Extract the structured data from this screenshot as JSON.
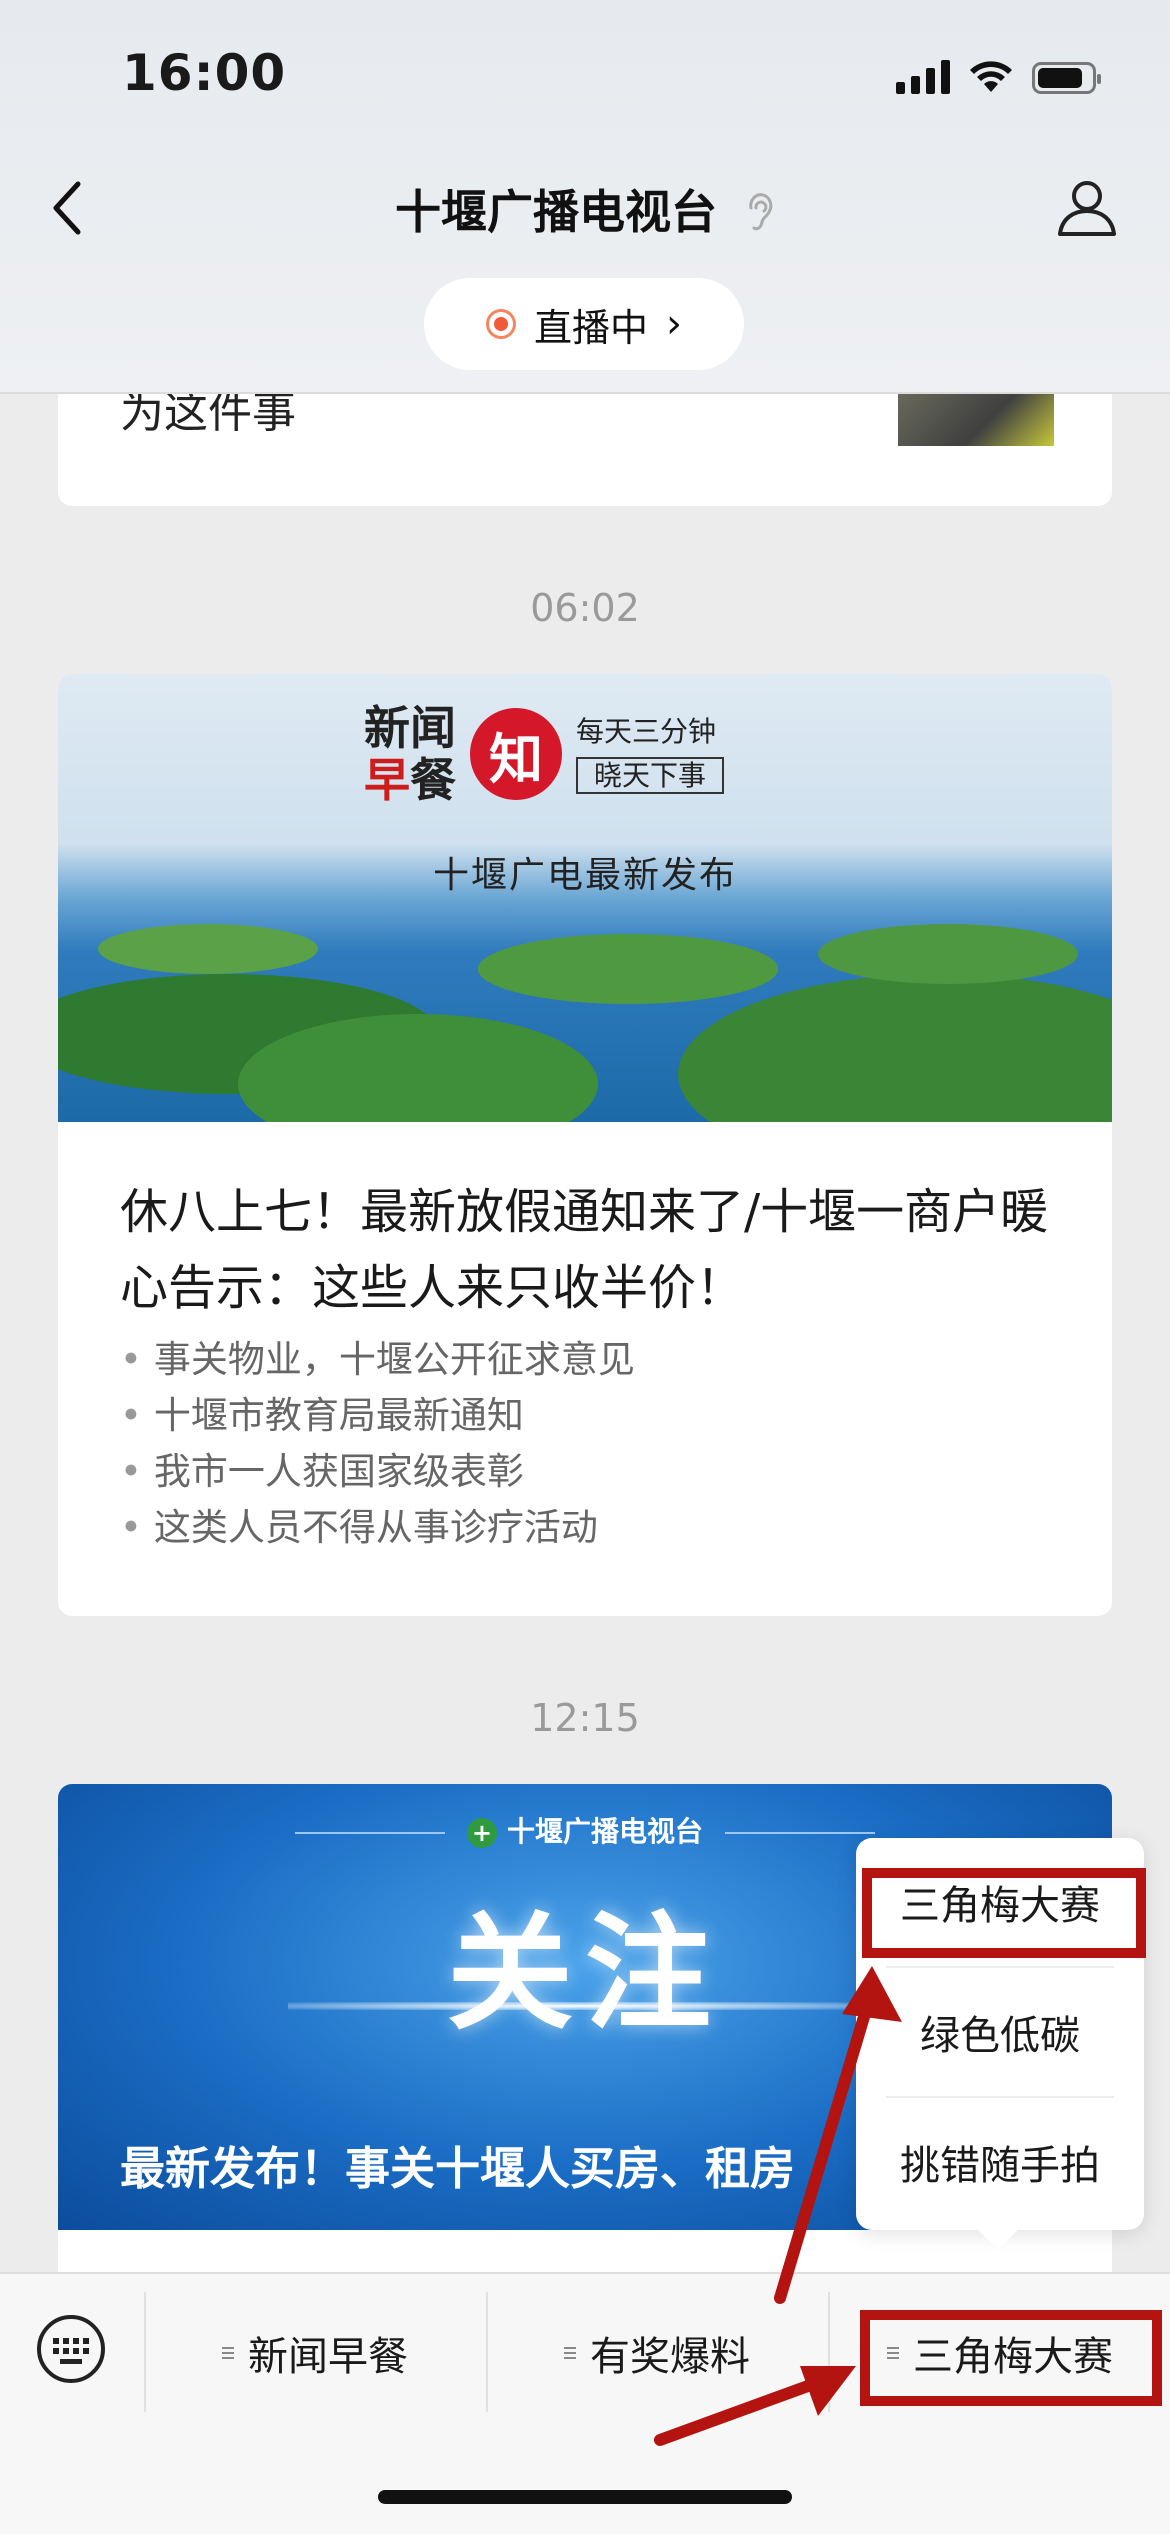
{
  "status_bar": {
    "time": "16:00"
  },
  "header": {
    "title": "十堰广播电视台",
    "live_label": "直播中"
  },
  "feed": [
    {
      "type": "article_tail",
      "text": "为这件事"
    },
    {
      "type": "timestamp",
      "text": "06:02"
    },
    {
      "type": "article",
      "banner": {
        "logo_line1": "新闻",
        "logo_line2_red": "早",
        "logo_line2": "餐",
        "logo_zhi": "知",
        "slogan1": "每天三分钟",
        "slogan2": "晓天下事",
        "subtitle": "十堰广电最新发布"
      },
      "title": "休八上七！最新放假通知来了/十堰一商户暖心告示：这些人来只收半价！",
      "bullets": [
        "事关物业，十堰公开征求意见",
        "十堰市教育局最新通知",
        "我市一人获国家级表彰",
        "这类人员不得从事诊疗活动"
      ]
    },
    {
      "type": "timestamp",
      "text": "12:15"
    },
    {
      "type": "article",
      "banner": {
        "header": "十堰广播电视台",
        "big_text": "关注",
        "caption": "最新发布！事关十堰人买房、租房"
      }
    }
  ],
  "popup_menu": {
    "items": [
      "三角梅大赛",
      "绿色低碳",
      "挑错随手拍"
    ]
  },
  "bottom_menu": {
    "tabs": [
      "新闻早餐",
      "有奖爆料",
      "三角梅大赛"
    ]
  },
  "colors": {
    "annotation_red": "#b3140f",
    "live_dot": "#f05a3a",
    "background": "#ececec"
  },
  "icons": [
    "back-chevron-icon",
    "ear-icon",
    "profile-icon",
    "live-dot-icon",
    "keyboard-icon",
    "menu-glyph-icon",
    "cross-logo-icon"
  ]
}
